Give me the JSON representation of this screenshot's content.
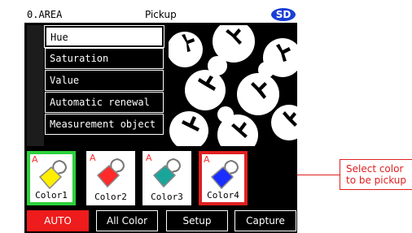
{
  "titlebar": {
    "area": "0.AREA",
    "title": "Pickup",
    "badge": "SD"
  },
  "menu": [
    {
      "label": "Hue",
      "selected": true
    },
    {
      "label": "Saturation",
      "selected": false
    },
    {
      "label": "Value",
      "selected": false
    },
    {
      "label": "Automatic renewal",
      "selected": false
    },
    {
      "label": "Measurement object",
      "selected": false
    }
  ],
  "colors": [
    {
      "label": "Color1",
      "mark": "A",
      "fill": "#ffee00",
      "active": "green"
    },
    {
      "label": "Color2",
      "mark": "A",
      "fill": "#ff2a2a",
      "active": ""
    },
    {
      "label": "Color3",
      "mark": "A",
      "fill": "#1aa59b",
      "active": ""
    },
    {
      "label": "Color4",
      "mark": "A",
      "fill": "#1a2fff",
      "active": "red"
    }
  ],
  "buttons": {
    "auto": "AUTO",
    "all_color": "All Color",
    "setup": "Setup",
    "capture": "Capture"
  },
  "callout": {
    "line1": "Select color",
    "line2": "to be pickup"
  },
  "accent_colors": {
    "auto": "#ee1c1c",
    "selected_green": "#2bd23b",
    "selected_red": "#e02020",
    "sd_badge": "#1a3fd6"
  }
}
